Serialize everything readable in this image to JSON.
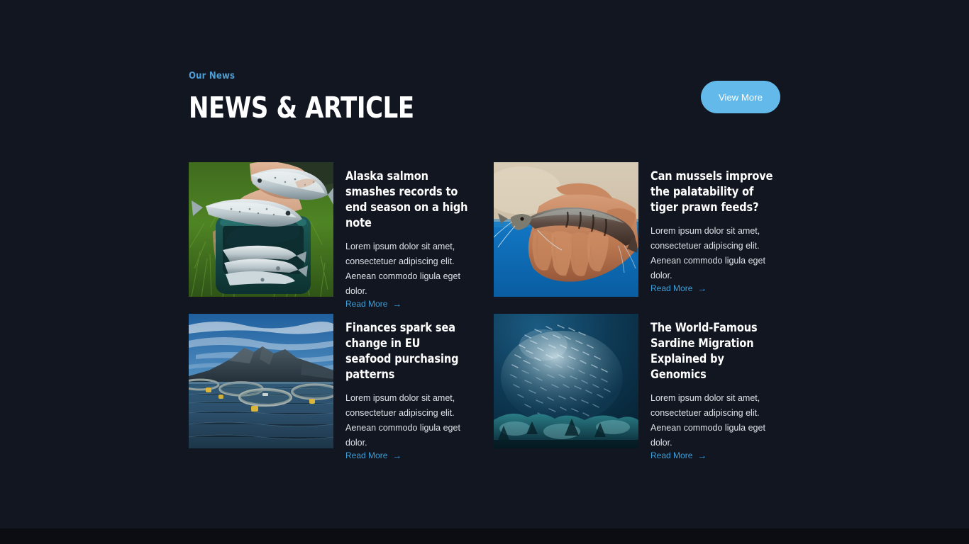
{
  "theme": {
    "background": "#111620",
    "footer_strip": "#0b0d13",
    "accent_blue": "#63baea",
    "link_blue": "#3f9fd8",
    "eyebrow_blue": "#4c9ed6",
    "title_color": "#ffffff",
    "body_color": "#dde2e8"
  },
  "header": {
    "eyebrow": "Our News",
    "title": "NEWS & ARTICLE",
    "view_more_label": "View More"
  },
  "cards": [
    {
      "title": "Alaska salmon smashes records to end season on a high note",
      "excerpt": "Lorem ipsum dolor sit amet, consectetuer adipiscing elit. Aenean commodo ligula eget dolor.",
      "link_label": "Read More",
      "link_arrow": "→",
      "image_name": "hands-holding-trout-over-cooler-on-grass"
    },
    {
      "title": "Can mussels improve the palatability of tiger prawn feeds?",
      "excerpt": "Lorem ipsum dolor sit amet, consectetuer adipiscing elit. Aenean commodo ligula eget dolor.",
      "link_label": "Read More",
      "link_arrow": "→",
      "image_name": "hand-holding-tiger-prawn"
    },
    {
      "title": "Finances spark sea change in EU seafood purchasing patterns",
      "excerpt": "Lorem ipsum dolor sit amet, consectetuer adipiscing elit. Aenean commodo ligula eget dolor.",
      "link_label": "Read More",
      "link_arrow": "→",
      "image_name": "fish-farm-pens-in-fjord-with-mountain"
    },
    {
      "title": "The World-Famous Sardine Migration Explained by Genomics",
      "excerpt": "Lorem ipsum dolor sit amet, consectetuer adipiscing elit. Aenean commodo ligula eget dolor.",
      "link_label": "Read More",
      "link_arrow": "→",
      "image_name": "sardine-bait-ball-underwater-over-reef"
    }
  ]
}
